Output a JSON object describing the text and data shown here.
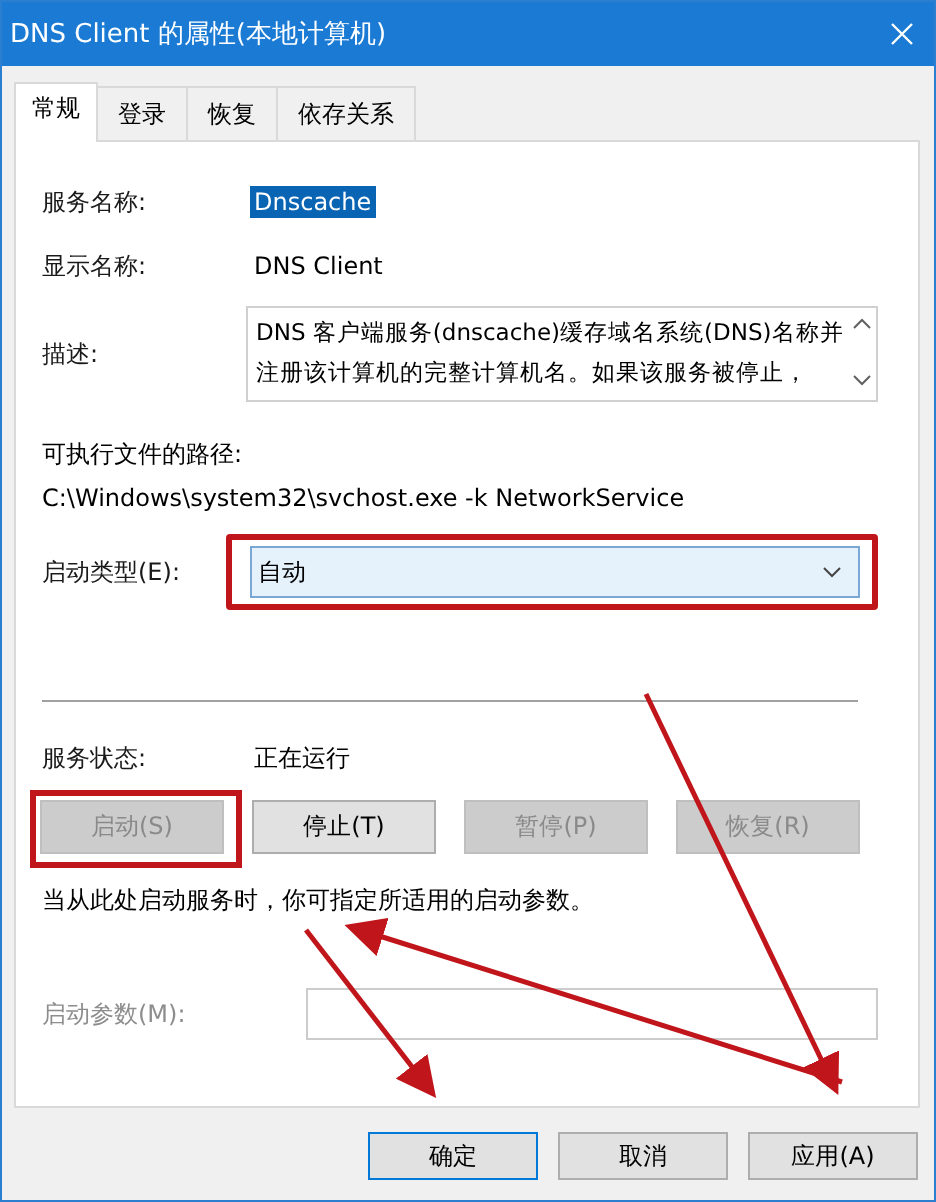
{
  "window": {
    "title": "DNS Client 的属性(本地计算机)"
  },
  "tabs": [
    {
      "label": "常规",
      "selected": true
    },
    {
      "label": "登录",
      "selected": false
    },
    {
      "label": "恢复",
      "selected": false
    },
    {
      "label": "依存关系",
      "selected": false
    }
  ],
  "service_name": {
    "label": "服务名称:",
    "value": "Dnscache",
    "selected": true
  },
  "display_name": {
    "label": "显示名称:",
    "value": "DNS Client"
  },
  "description": {
    "label": "描述:",
    "text": "DNS 客户端服务(dnscache)缓存域名系统(DNS)名称并注册该计算机的完整计算机名。如果该服务被停止，"
  },
  "executable_path": {
    "label": "可执行文件的路径:",
    "value": "C:\\Windows\\system32\\svchost.exe -k NetworkService"
  },
  "startup_type": {
    "label": "启动类型(E):",
    "value": "自动",
    "highlighted": true
  },
  "service_status": {
    "label": "服务状态:",
    "value": "正在运行"
  },
  "service_buttons": [
    {
      "label": "启动(S)",
      "disabled": true,
      "highlighted": true
    },
    {
      "label": "停止(T)",
      "disabled": false,
      "highlighted": false
    },
    {
      "label": "暂停(P)",
      "disabled": true,
      "highlighted": false
    },
    {
      "label": "恢复(R)",
      "disabled": true,
      "highlighted": false
    }
  ],
  "hint": "当从此处启动服务时，你可指定所适用的启动参数。",
  "start_parameters": {
    "label": "启动参数(M):",
    "disabled": true
  },
  "dialog_buttons": [
    {
      "label": "确定",
      "default": true
    },
    {
      "label": "取消",
      "default": false
    },
    {
      "label": "应用(A)",
      "default": false
    }
  ]
}
